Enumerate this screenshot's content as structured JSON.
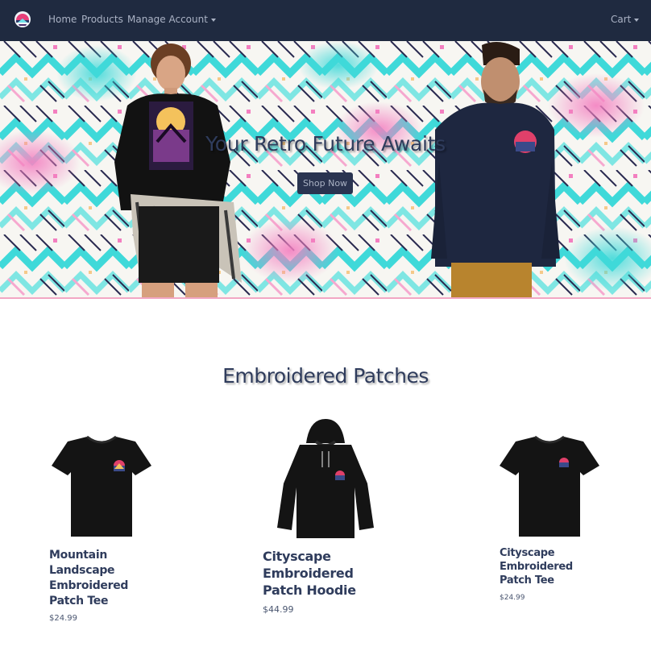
{
  "nav": {
    "logo": "logo-icon",
    "items": [
      {
        "label": "Home"
      },
      {
        "label": "Products"
      },
      {
        "label": "Manage Account"
      }
    ],
    "cart_label": "Cart"
  },
  "hero": {
    "title": "Your Retro Future Awaits",
    "button_label": "Shop Now"
  },
  "section": {
    "title": "Embroidered Patches"
  },
  "products": [
    {
      "name": "Mountain Landscape Embroidered Patch Tee",
      "price": "$24.99",
      "image": "black-tee-patch"
    },
    {
      "name": "Cityscape Embroidered Patch Hoodie",
      "price": "$44.99",
      "image": "black-hoodie-patch"
    },
    {
      "name": "Cityscape Embroidered Patch Tee",
      "price": "$24.99",
      "image": "black-tee-patch"
    }
  ],
  "colors": {
    "navbar": "#1f2a40",
    "nav_text": "#aab2c4",
    "heading": "#2f3c5c",
    "hero_cyan": "#3fd9d9",
    "hero_pink": "#f37fc0"
  }
}
